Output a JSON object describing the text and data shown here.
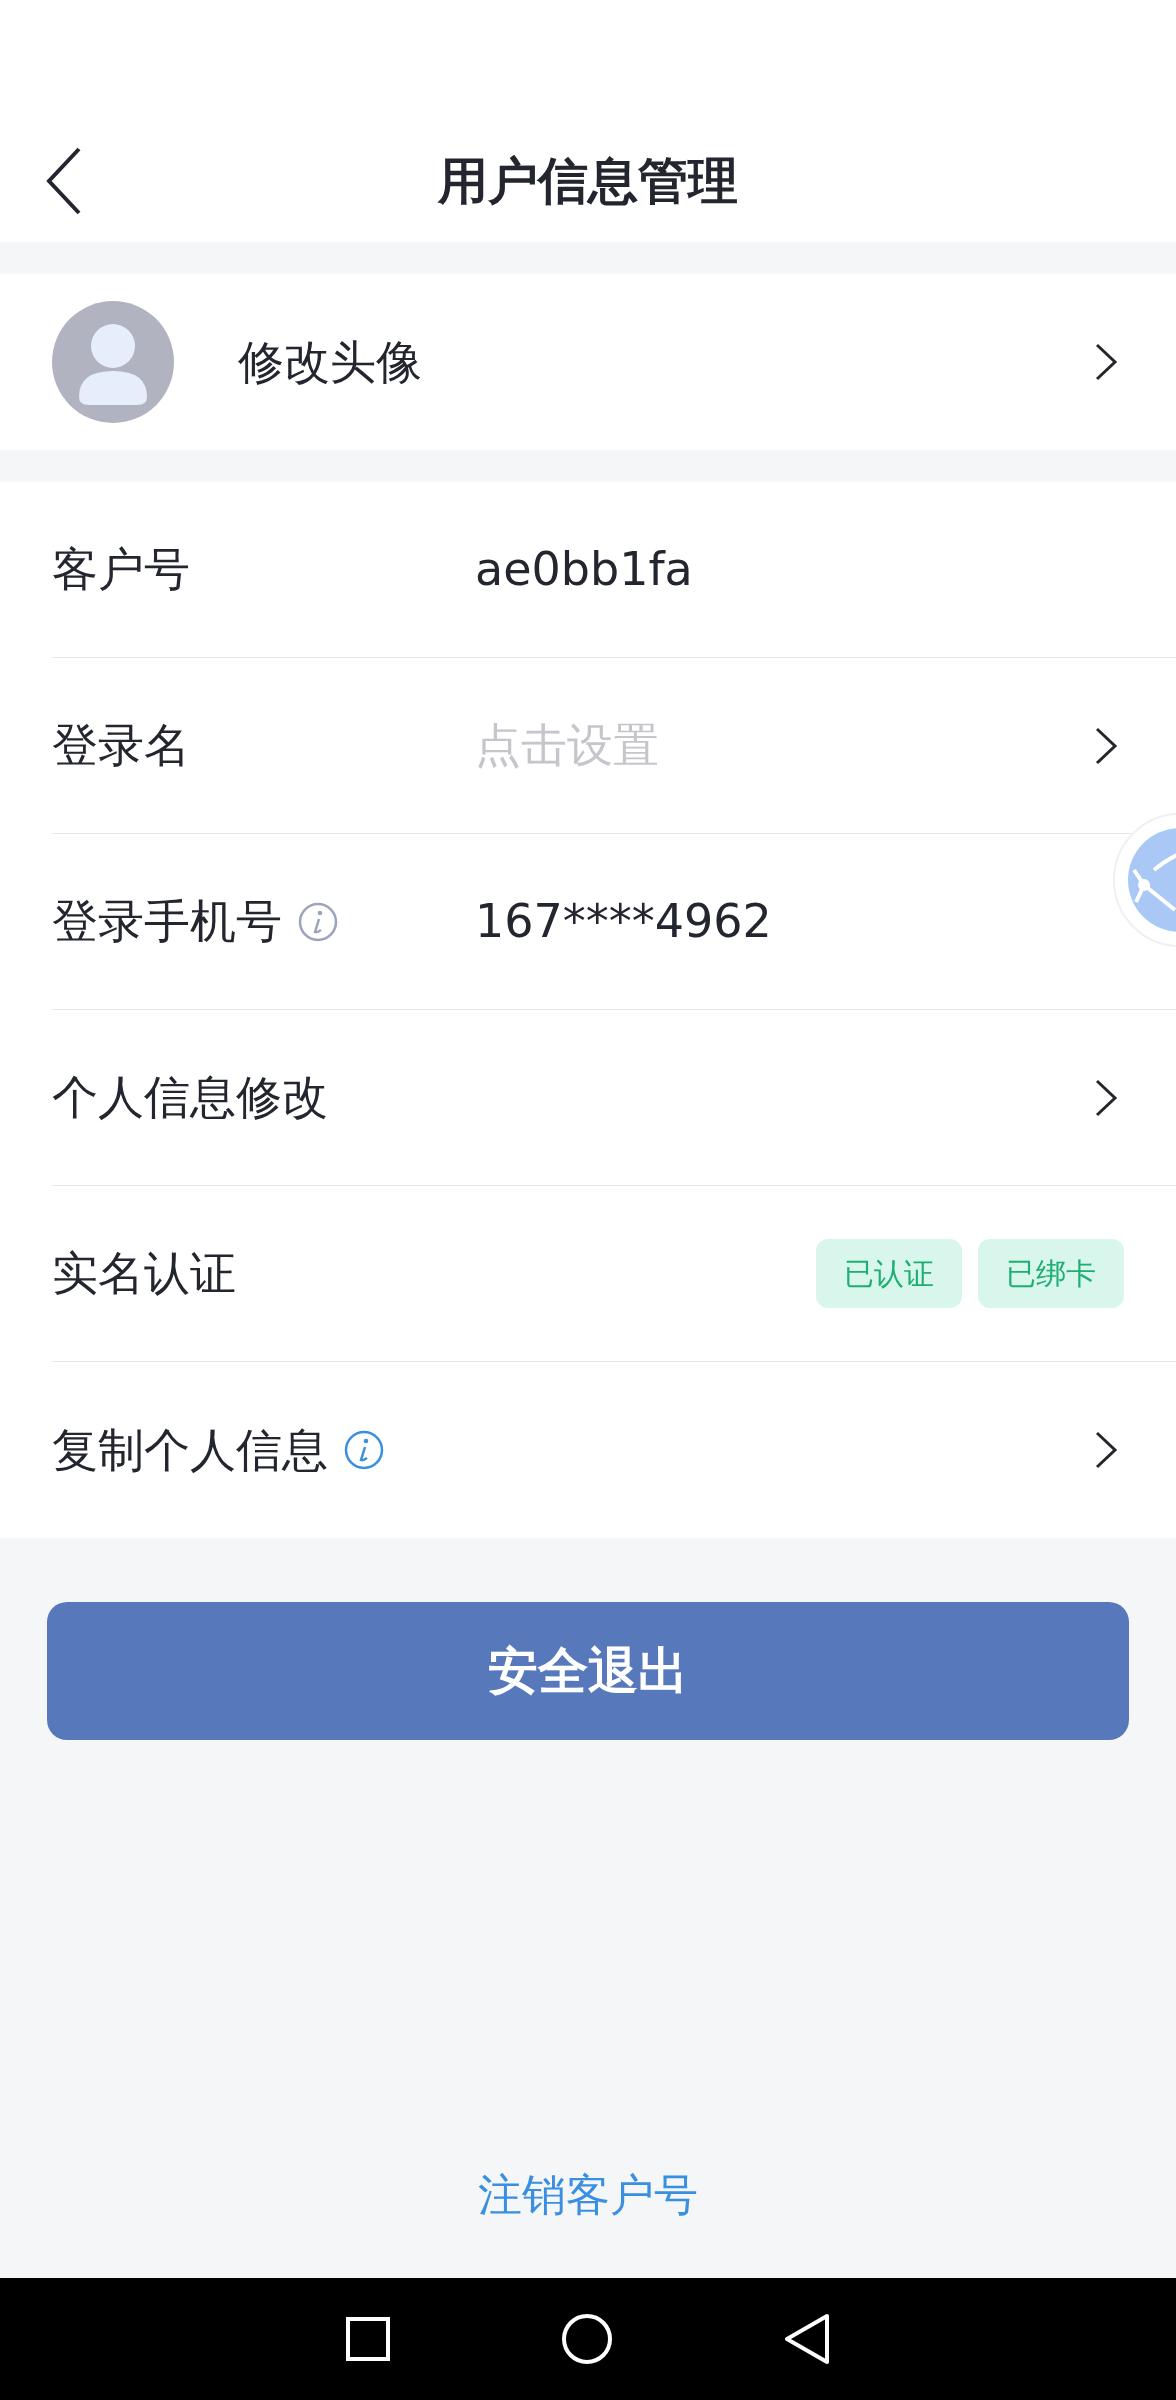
{
  "header": {
    "title": "用户信息管理"
  },
  "avatar_row": {
    "label": "修改头像"
  },
  "rows": [
    {
      "label": "客户号",
      "value": "ae0bb1fa",
      "chevron": false
    },
    {
      "label": "登录名",
      "placeholder": "点击设置",
      "chevron": true
    },
    {
      "label": "登录手机号",
      "info_icon": {
        "color": "#9ea3bd"
      },
      "value": "167****4962",
      "chevron": false
    },
    {
      "label": "个人信息修改",
      "chevron": true
    },
    {
      "label": "实名认证",
      "badges": [
        "已认证",
        "已绑卡"
      ],
      "chevron": false
    },
    {
      "label": "复制个人信息",
      "info_icon": {
        "color": "#3b8fe0"
      },
      "chevron": true
    }
  ],
  "logout_button": "安全退出",
  "cancel_link": "注销客户号"
}
